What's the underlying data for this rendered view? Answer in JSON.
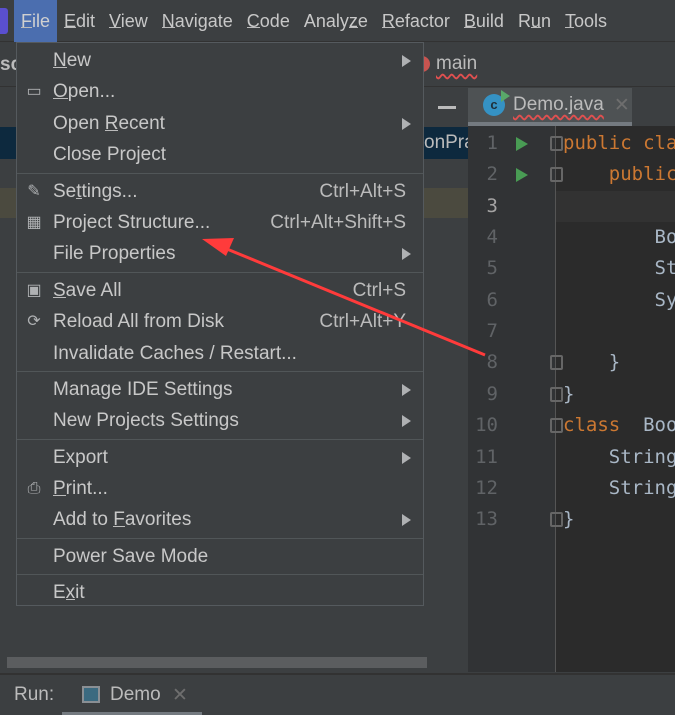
{
  "menubar": {
    "items": [
      {
        "label": "File",
        "mnemonic": 0,
        "active": true
      },
      {
        "label": "Edit",
        "mnemonic": 0
      },
      {
        "label": "View",
        "mnemonic": 0
      },
      {
        "label": "Navigate",
        "mnemonic": 0
      },
      {
        "label": "Code",
        "mnemonic": 0
      },
      {
        "label": "Analyze",
        "mnemonic": 5
      },
      {
        "label": "Refactor",
        "mnemonic": 0
      },
      {
        "label": "Build",
        "mnemonic": 0
      },
      {
        "label": "Run",
        "mnemonic": 1
      },
      {
        "label": "Tools",
        "mnemonic": 0
      }
    ]
  },
  "navbar": {
    "project_fragment": "sc",
    "method": "main"
  },
  "project_panel": {
    "selected_fragment": "onPrac"
  },
  "editor": {
    "tab": {
      "label": "Demo.java",
      "icon": "java-class-icon"
    },
    "lines": [
      {
        "n": "1",
        "run": true,
        "fold": true,
        "parts": [
          {
            "t": "public cla",
            "kw": true
          }
        ]
      },
      {
        "n": "2",
        "run": true,
        "fold": true,
        "parts": [
          {
            "t": "    "
          },
          {
            "t": "public",
            "kw": true
          }
        ]
      },
      {
        "n": "3",
        "current": true,
        "parts": []
      },
      {
        "n": "4",
        "parts": [
          {
            "t": "        Bo"
          }
        ]
      },
      {
        "n": "5",
        "parts": [
          {
            "t": "        St"
          }
        ]
      },
      {
        "n": "6",
        "parts": [
          {
            "t": "        Sy"
          }
        ]
      },
      {
        "n": "7",
        "parts": []
      },
      {
        "n": "8",
        "fold": true,
        "parts": [
          {
            "t": "    }"
          }
        ]
      },
      {
        "n": "9",
        "fold": true,
        "parts": [
          {
            "t": "}"
          }
        ]
      },
      {
        "n": "10",
        "fold": true,
        "parts": [
          {
            "t": "class",
            "kw": true
          },
          {
            "t": "  Boo"
          }
        ]
      },
      {
        "n": "11",
        "parts": [
          {
            "t": "    String"
          }
        ]
      },
      {
        "n": "12",
        "parts": [
          {
            "t": "    String"
          }
        ]
      },
      {
        "n": "13",
        "fold": true,
        "parts": [
          {
            "t": "}"
          }
        ]
      }
    ]
  },
  "file_menu": {
    "groups": [
      [
        {
          "label": "New",
          "mnemonic": 0,
          "submenu": true
        },
        {
          "label": "Open...",
          "mnemonic": 0,
          "icon": "folder-open-icon"
        },
        {
          "label": "Open Recent",
          "mnemonic": 5,
          "submenu": true
        },
        {
          "label": "Close Project"
        }
      ],
      [
        {
          "label": "Settings...",
          "mnemonic": 2,
          "shortcut": "Ctrl+Alt+S",
          "icon": "wrench-icon"
        },
        {
          "label": "Project Structure...",
          "shortcut": "Ctrl+Alt+Shift+S",
          "icon": "project-structure-icon"
        },
        {
          "label": "File Properties",
          "submenu": true
        }
      ],
      [
        {
          "label": "Save All",
          "mnemonic": 0,
          "shortcut": "Ctrl+S",
          "icon": "save-icon"
        },
        {
          "label": "Reload All from Disk",
          "shortcut": "Ctrl+Alt+Y",
          "icon": "reload-icon"
        },
        {
          "label": "Invalidate Caches / Restart..."
        }
      ],
      [
        {
          "label": "Manage IDE Settings",
          "submenu": true
        },
        {
          "label": "New Projects Settings",
          "submenu": true
        }
      ],
      [
        {
          "label": "Export",
          "submenu": true
        },
        {
          "label": "Print...",
          "mnemonic": 0,
          "icon": "print-icon"
        },
        {
          "label": "Add to Favorites",
          "mnemonic": 7,
          "submenu": true
        }
      ],
      [
        {
          "label": "Power Save Mode"
        }
      ],
      [
        {
          "label": "Exit",
          "mnemonic": 1
        }
      ]
    ]
  },
  "bottom": {
    "run_label": "Run:",
    "run_tab": "Demo"
  },
  "colors": {
    "accent": "#4b6eaf",
    "annotation_arrow": "#ff3b3b",
    "keyword": "#cc7832"
  }
}
